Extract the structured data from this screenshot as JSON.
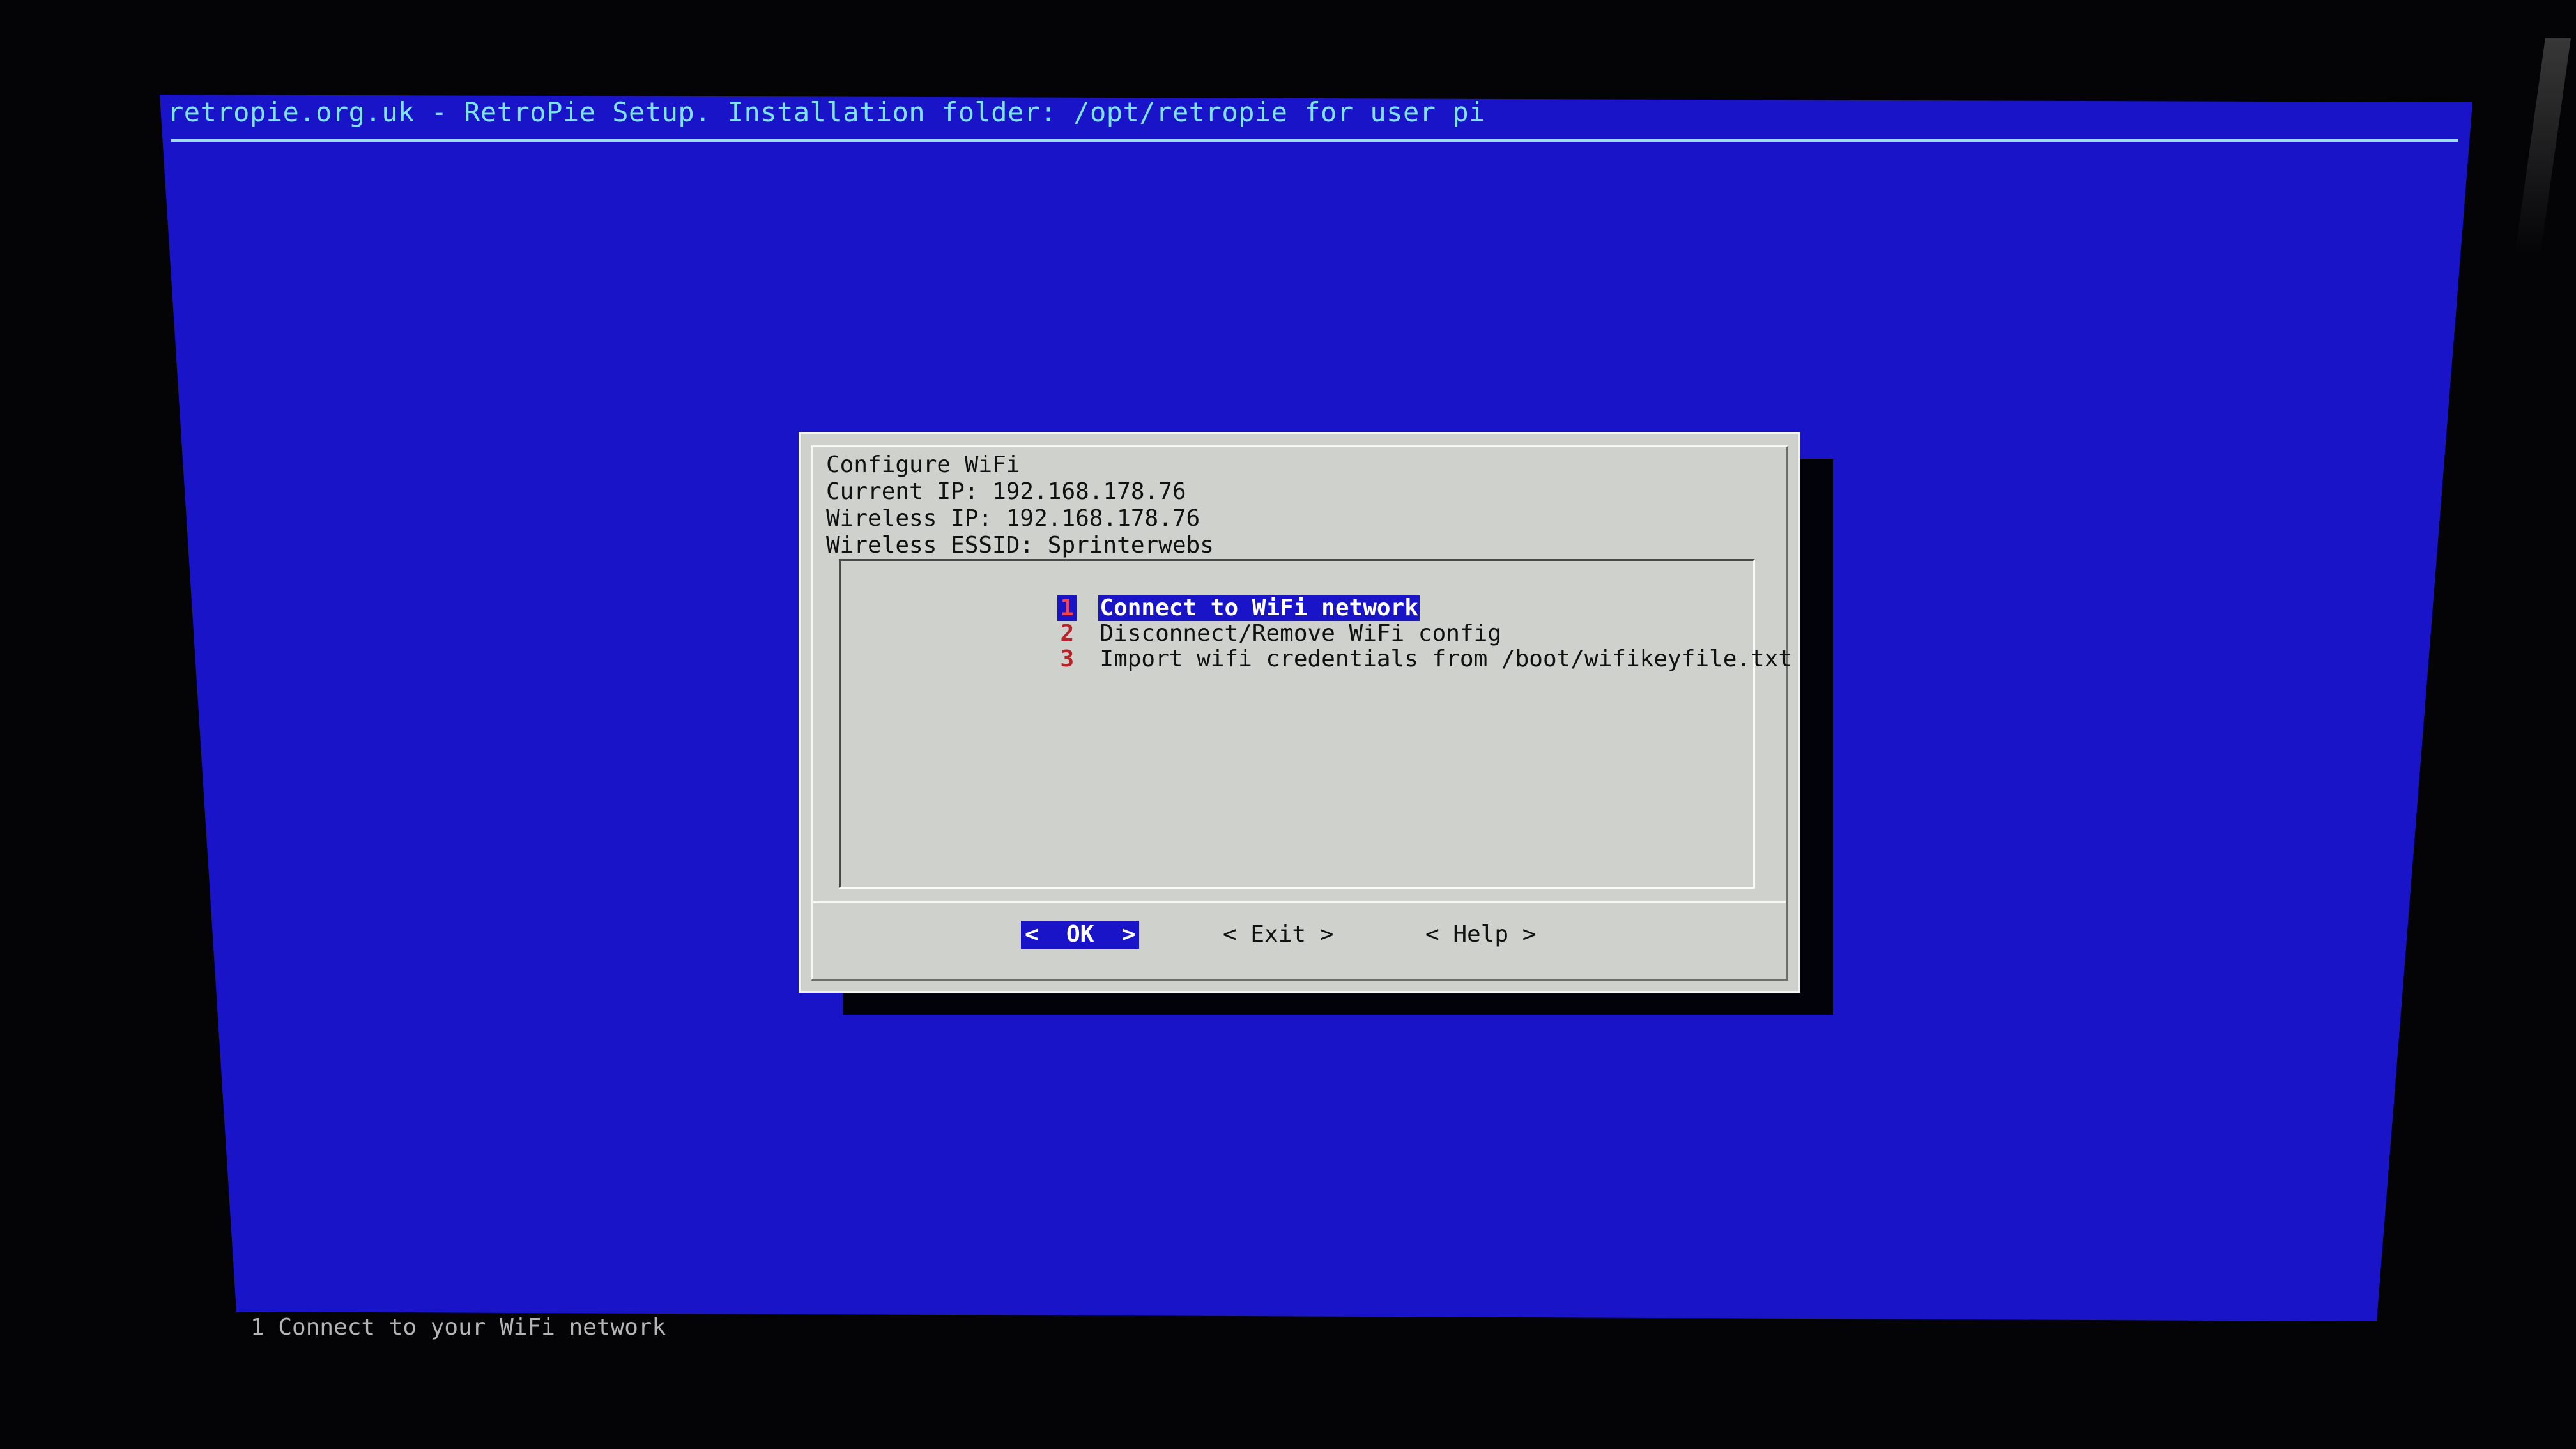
{
  "backtitle": "retropie.org.uk - RetroPie Setup. Installation folder: /opt/retropie for user pi",
  "dialog": {
    "title": "Configure WiFi",
    "info_lines": [
      "Current IP: 192.168.178.76",
      "Wireless IP: 192.168.178.76",
      "Wireless ESSID: Sprinterwebs"
    ],
    "menu": [
      {
        "tag": "1",
        "label": "Connect to WiFi network",
        "selected": true
      },
      {
        "tag": "2",
        "label": "Disconnect/Remove WiFi config",
        "selected": false
      },
      {
        "tag": "3",
        "label": "Import wifi credentials from /boot/wifikeyfile.txt",
        "selected": false
      }
    ],
    "buttons": {
      "ok": "<  OK  >",
      "exit": "< Exit >",
      "help": "< Help >"
    }
  },
  "status_line": "1 Connect to your WiFi network",
  "colors": {
    "screen_background": "#1a14c8",
    "dialog_background": "#cfd1cc",
    "selection": "#1a14c8",
    "menu_tag": "#b8232a",
    "backtitle_text": "#7fe3ee"
  }
}
